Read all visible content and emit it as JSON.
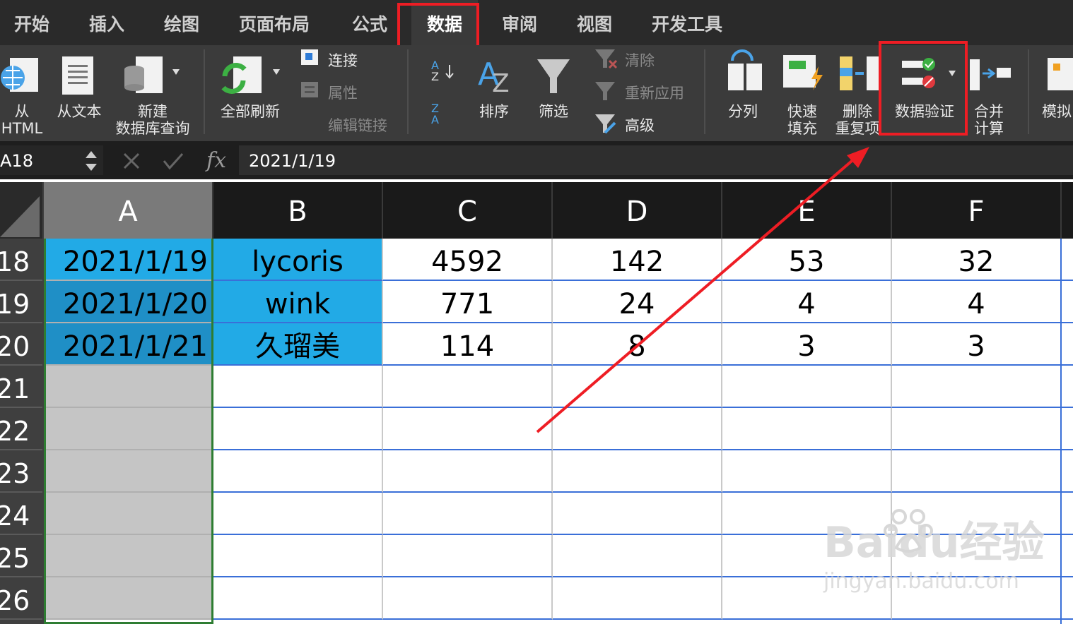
{
  "ribbon_tabs": [
    "开始",
    "插入",
    "绘图",
    "页面布局",
    "公式",
    "数据",
    "审阅",
    "视图",
    "开发工具"
  ],
  "active_tab": "数据",
  "ribbon": {
    "from_html": [
      "从",
      "HTML"
    ],
    "from_text": "从文本",
    "new_query": [
      "新建",
      "数据库查询"
    ],
    "refresh_all": "全部刷新",
    "connections": "连接",
    "properties": "属性",
    "edit_links": "编辑链接",
    "sort": "排序",
    "filter": "筛选",
    "clear": "清除",
    "reapply": "重新应用",
    "advanced": "高级",
    "text_to_columns": "分列",
    "flash_fill": [
      "快速",
      "填充"
    ],
    "remove_duplicates": [
      "删除",
      "重复项"
    ],
    "data_validation": "数据验证",
    "consolidate": [
      "合并",
      "计算"
    ],
    "what_if": "模拟"
  },
  "formula_bar": {
    "name_box": "A18",
    "fx": "fx",
    "value": "2021/1/19"
  },
  "columns": [
    "A",
    "B",
    "C",
    "D",
    "E",
    "F"
  ],
  "rows": [
    {
      "num": "18",
      "cells": [
        "2021/1/19",
        "lycoris",
        "4592",
        "142",
        "53",
        "32"
      ]
    },
    {
      "num": "19",
      "cells": [
        "2021/1/20",
        "wink",
        "771",
        "24",
        "4",
        "4"
      ]
    },
    {
      "num": "20",
      "cells": [
        "2021/1/21",
        "久瑠美",
        "114",
        "8",
        "3",
        "3"
      ]
    },
    {
      "num": "21",
      "cells": [
        "",
        "",
        "",
        "",
        "",
        ""
      ]
    },
    {
      "num": "22",
      "cells": [
        "",
        "",
        "",
        "",
        "",
        ""
      ]
    },
    {
      "num": "23",
      "cells": [
        "",
        "",
        "",
        "",
        "",
        ""
      ]
    },
    {
      "num": "24",
      "cells": [
        "",
        "",
        "",
        "",
        "",
        ""
      ]
    },
    {
      "num": "25",
      "cells": [
        "",
        "",
        "",
        "",
        "",
        ""
      ]
    },
    {
      "num": "26",
      "cells": [
        "",
        "",
        "",
        "",
        "",
        ""
      ]
    }
  ],
  "watermark": {
    "brand": "Baidu经验",
    "url": "jingyan.baidu.com"
  },
  "colors": {
    "highlight": "#ee1d24",
    "selection_blue": "#22aae6",
    "arrow": "#ee1d24"
  }
}
